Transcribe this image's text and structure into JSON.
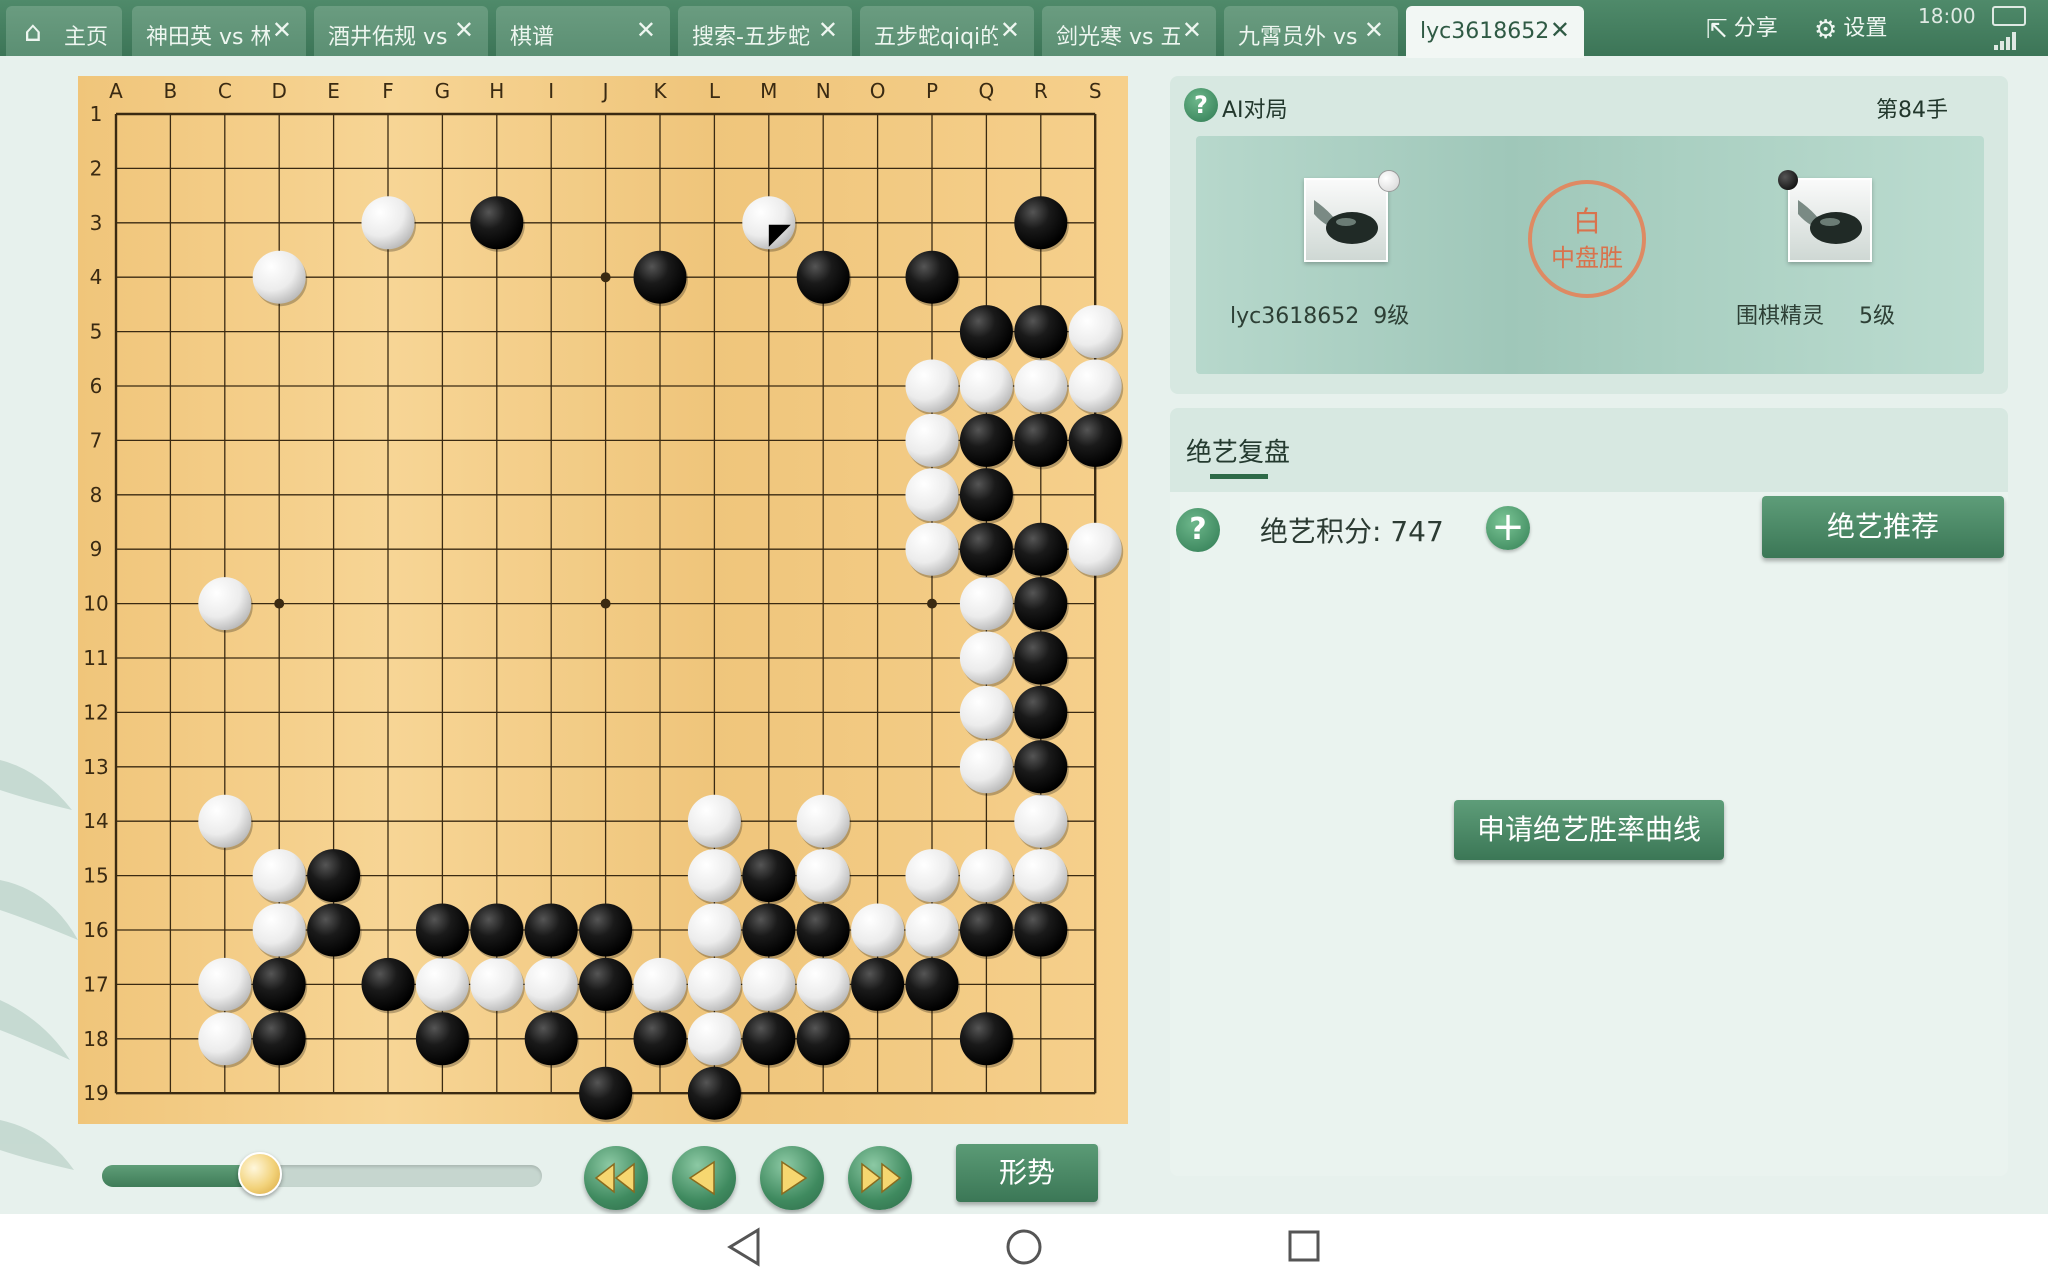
{
  "tabs": [
    {
      "label": "主页",
      "icon": "home-icon"
    },
    {
      "label": "神田英 vs 林"
    },
    {
      "label": "酒井佑规 vs"
    },
    {
      "label": "棋谱"
    },
    {
      "label": "搜索-五步蛇"
    },
    {
      "label": "五步蛇qiqi的"
    },
    {
      "label": "剑光寒 vs 五"
    },
    {
      "label": "九霄员外 vs"
    },
    {
      "label": "lyc3618652",
      "active": true
    }
  ],
  "topbar": {
    "share_label": "分享",
    "settings_label": "设置",
    "clock": "18:00"
  },
  "board": {
    "size": 19,
    "columns": [
      "A",
      "B",
      "C",
      "D",
      "E",
      "F",
      "G",
      "H",
      "I",
      "J",
      "K",
      "L",
      "M",
      "N",
      "O",
      "P",
      "Q",
      "R",
      "S"
    ],
    "rows": [
      "1",
      "2",
      "3",
      "4",
      "5",
      "6",
      "7",
      "8",
      "9",
      "10",
      "11",
      "12",
      "13",
      "14",
      "15",
      "16",
      "17",
      "18",
      "19"
    ],
    "black": [
      "H3",
      "R3",
      "K4",
      "N4",
      "P4",
      "Q5",
      "R5",
      "Q7",
      "R7",
      "S7",
      "Q8",
      "Q9",
      "R9",
      "R10",
      "R11",
      "R12",
      "R13",
      "E15",
      "M15",
      "E16",
      "G16",
      "H16",
      "I16",
      "J16",
      "M16",
      "N16",
      "Q16",
      "R16",
      "D17",
      "F17",
      "J17",
      "O17",
      "P17",
      "D18",
      "G18",
      "I18",
      "K18",
      "M18",
      "N18",
      "Q18",
      "J19",
      "L19"
    ],
    "white": [
      "F3",
      "M3",
      "D4",
      "S5",
      "P6",
      "Q6",
      "R6",
      "S6",
      "P7",
      "P8",
      "P9",
      "S9",
      "C10",
      "Q10",
      "Q11",
      "Q12",
      "Q13",
      "C14",
      "L14",
      "N14",
      "R14",
      "D15",
      "L15",
      "N15",
      "P15",
      "Q15",
      "R15",
      "D16",
      "L16",
      "O16",
      "P16",
      "C17",
      "G17",
      "H17",
      "I17",
      "K17",
      "L17",
      "M17",
      "N17",
      "C18",
      "L18"
    ],
    "last_move": "M3"
  },
  "controls": {
    "slider_progress": 0.36,
    "trend_label": "形势"
  },
  "game": {
    "type_label": "AI对局",
    "move_label": "第84手",
    "left_player": {
      "name": "lyc3618652",
      "rank": "9级",
      "stone": "white"
    },
    "right_player": {
      "name": "围棋精灵",
      "rank": "5级",
      "stone": "black"
    },
    "result_color": "白",
    "result_text": "中盘胜"
  },
  "ai": {
    "tab_label": "绝艺复盘",
    "score_label": "绝艺积分: 747",
    "recommend_label": "绝艺推荐",
    "curve_label": "申请绝艺胜率曲线"
  }
}
